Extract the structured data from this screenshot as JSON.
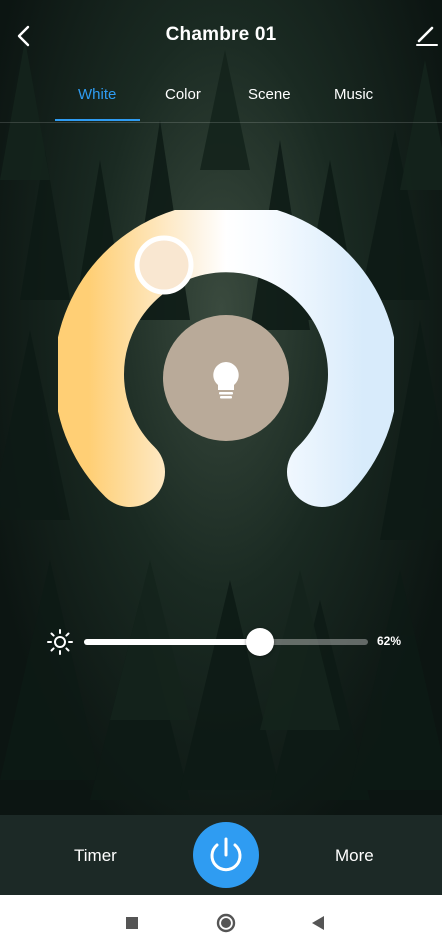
{
  "header": {
    "title": "Chambre 01",
    "back_icon": "chevron-left-icon",
    "edit_icon": "pencil-icon"
  },
  "tabs": [
    {
      "label": "White",
      "active": true
    },
    {
      "label": "Color",
      "active": false
    },
    {
      "label": "Scene",
      "active": false
    },
    {
      "label": "Music",
      "active": false
    }
  ],
  "wheel": {
    "warm_color": "#ffcf75",
    "cool_color": "#d8ebfb",
    "selected_color": "#f9e7d1",
    "center_color": "#b9aa99",
    "center_icon": "bulb-icon"
  },
  "brightness": {
    "icon": "sun-icon",
    "level": 0.62,
    "value_text": "62%"
  },
  "actions": {
    "timer_label": "Timer",
    "more_label": "More",
    "power_icon": "power-icon",
    "accent": "#2f9cf2"
  },
  "system_nav": {
    "recents_icon": "square-icon",
    "home_icon": "circle-icon",
    "back_icon": "triangle-back-icon"
  }
}
